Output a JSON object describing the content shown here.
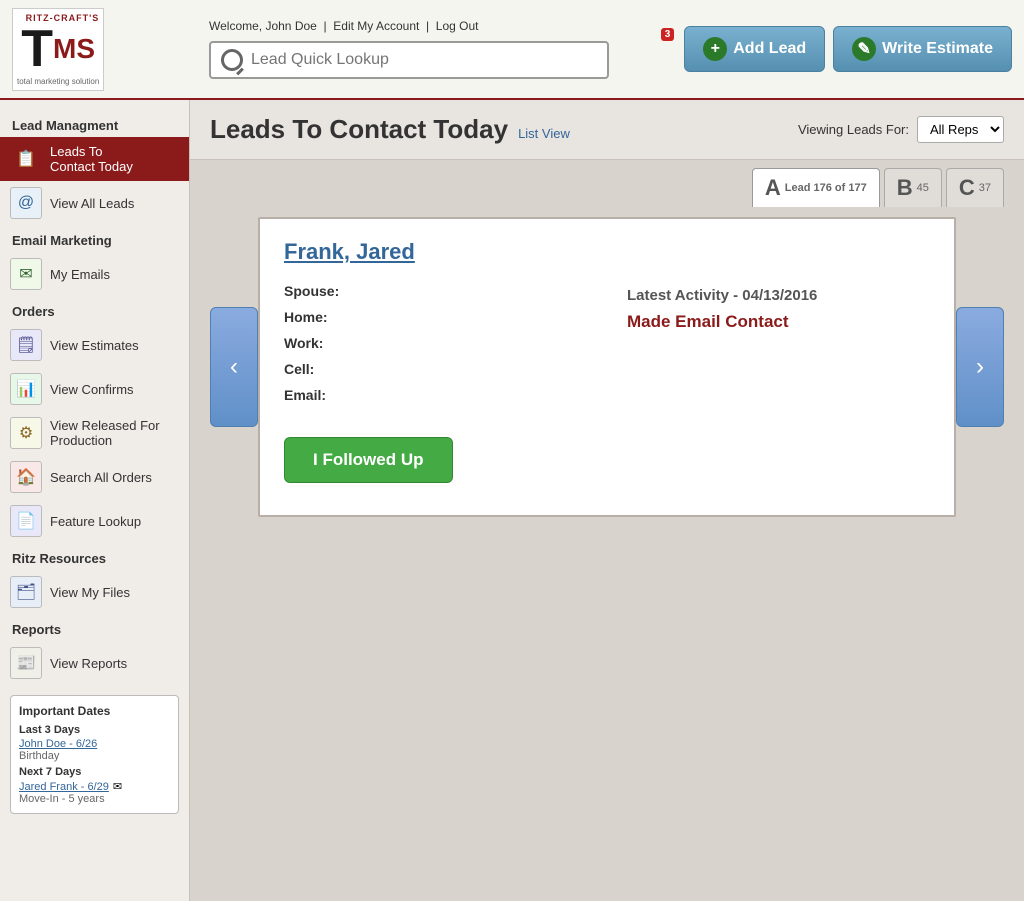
{
  "header": {
    "welcome_text": "Welcome, John Doe",
    "edit_account": "Edit My Account",
    "log_out": "Log Out",
    "search_placeholder": "Lead Quick Lookup",
    "add_lead_label": "Add Lead",
    "write_estimate_label": "Write Estimate",
    "notification_count": "3"
  },
  "sidebar": {
    "lead_management_title": "Lead Managment",
    "items": [
      {
        "id": "leads-today",
        "label": "Leads To\nContact Today",
        "active": true
      },
      {
        "id": "view-all-leads",
        "label": "View All Leads",
        "active": false
      }
    ],
    "email_marketing_title": "Email Marketing",
    "email_items": [
      {
        "id": "my-emails",
        "label": "My Emails",
        "active": false
      }
    ],
    "orders_title": "Orders",
    "order_items": [
      {
        "id": "view-estimates",
        "label": "View Estimates",
        "active": false
      },
      {
        "id": "view-confirms",
        "label": "View Confirms",
        "active": false
      },
      {
        "id": "view-released",
        "label": "View Released For Production",
        "active": false
      },
      {
        "id": "search-all-orders",
        "label": "Search All Orders",
        "active": false
      },
      {
        "id": "feature-lookup",
        "label": "Feature Lookup",
        "active": false
      }
    ],
    "ritz_resources_title": "Ritz Resources",
    "ritz_items": [
      {
        "id": "view-my-files",
        "label": "View My Files",
        "active": false
      }
    ],
    "reports_title": "Reports",
    "report_items": [
      {
        "id": "view-reports",
        "label": "View Reports",
        "active": false
      }
    ],
    "important_dates": {
      "title": "Important Dates",
      "last3": "Last 3 Days",
      "person1_name": "John Doe - 6/26",
      "person1_event": "Birthday",
      "next7": "Next 7 Days",
      "person2_name": "Jared Frank - 6/29",
      "person2_event": "Move-In - 5 years"
    }
  },
  "content": {
    "page_title": "Leads To Contact Today",
    "list_view_label": "List View",
    "viewing_label": "Viewing Leads For:",
    "viewing_options": [
      "All Reps"
    ],
    "viewing_selected": "All Reps",
    "tabs": [
      {
        "letter": "A",
        "label": "Lead 176 of 177",
        "count": "",
        "active": true
      },
      {
        "letter": "B",
        "count": "45",
        "active": false
      },
      {
        "letter": "C",
        "count": "37",
        "active": false
      }
    ],
    "lead": {
      "name": "Frank, Jared",
      "spouse": "",
      "home": "",
      "work": "",
      "cell": "",
      "email": "",
      "activity_label": "Latest Activity - 04/13/2016",
      "activity_status": "Made Email Contact",
      "followed_up_label": "I Followed Up"
    }
  }
}
